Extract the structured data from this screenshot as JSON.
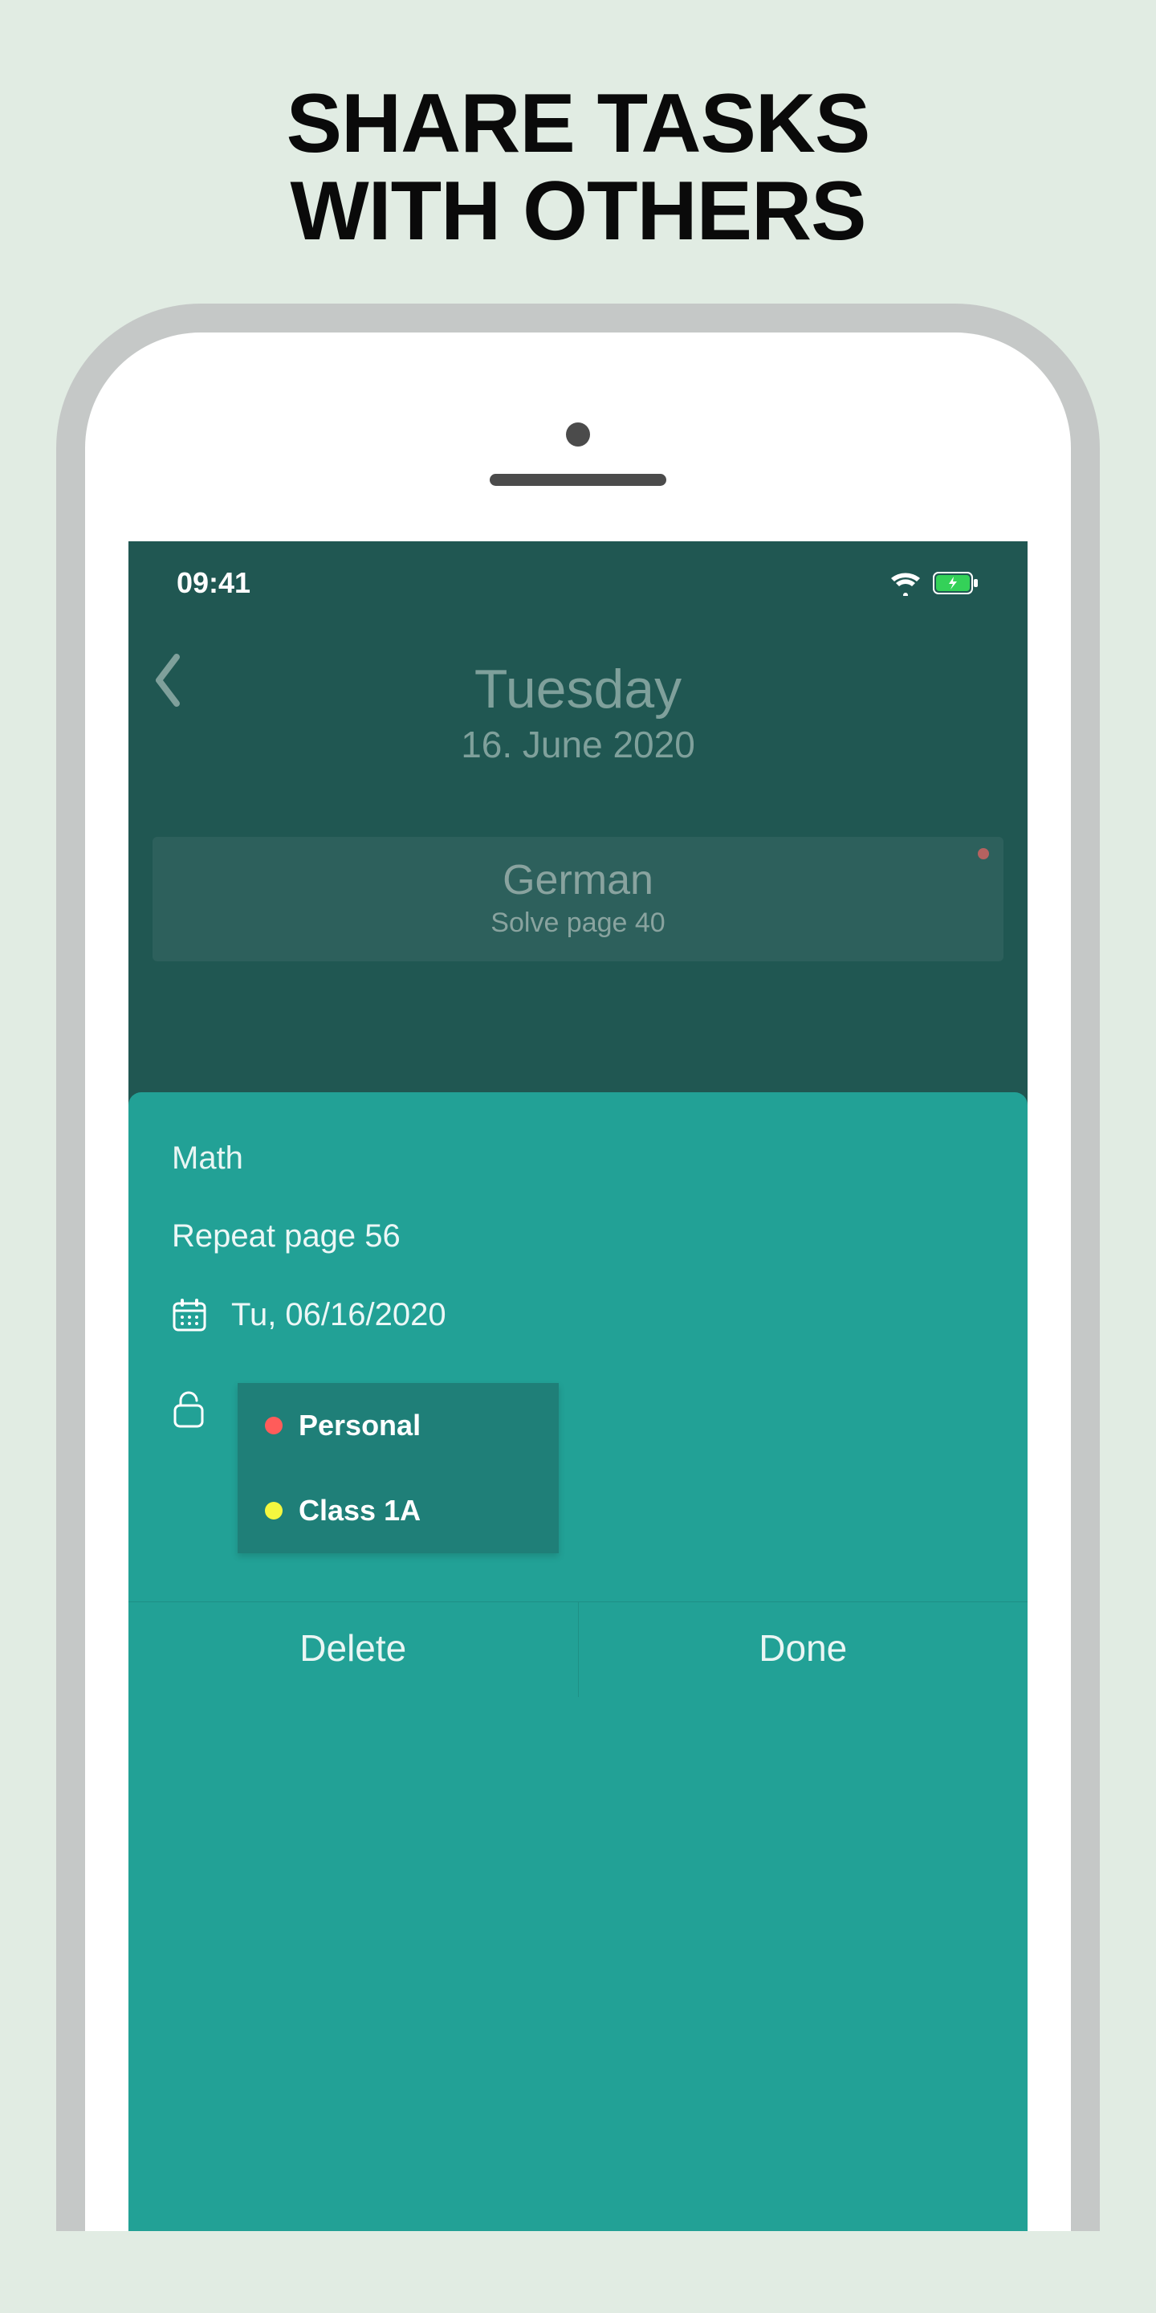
{
  "headline_line1": "SHARE TASKS",
  "headline_line2": "WITH OTHERS",
  "status": {
    "time": "09:41"
  },
  "nav": {
    "day": "Tuesday",
    "date": "16. June 2020"
  },
  "task_card": {
    "subject": "German",
    "description": "Solve page 40"
  },
  "sheet": {
    "subject": "Math",
    "description": "Repeat page 56",
    "date": "Tu, 06/16/2020",
    "share_options": [
      {
        "label": "Personal",
        "color": "red"
      },
      {
        "label": "Class 1A",
        "color": "yellow"
      }
    ],
    "buttons": {
      "delete": "Delete",
      "done": "Done"
    }
  }
}
